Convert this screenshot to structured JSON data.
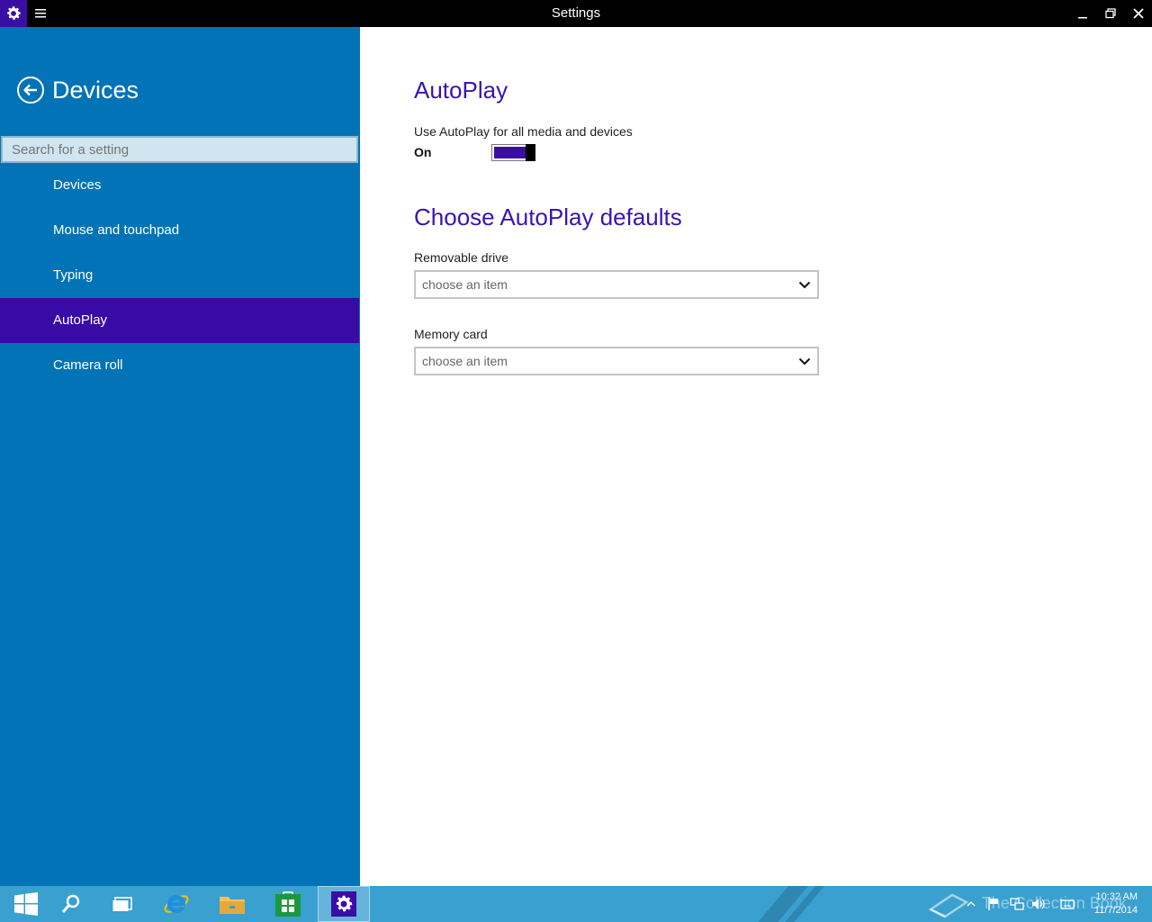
{
  "window": {
    "title": "Settings",
    "minimize_icon": "minimize-icon",
    "restore_icon": "restore-icon",
    "close_icon": "close-icon"
  },
  "sidebar": {
    "title": "Devices",
    "search_placeholder": "Search for a setting",
    "items": [
      {
        "label": "Devices"
      },
      {
        "label": "Mouse and touchpad"
      },
      {
        "label": "Typing"
      },
      {
        "label": "AutoPlay",
        "active": true
      },
      {
        "label": "Camera roll"
      }
    ]
  },
  "main": {
    "heading": "AutoPlay",
    "toggle_label": "Use AutoPlay for all media and devices",
    "toggle_state": "On",
    "defaults_heading": "Choose AutoPlay defaults",
    "removable_label": "Removable drive",
    "removable_value": "choose an item",
    "memory_label": "Memory card",
    "memory_value": "choose an item"
  },
  "taskbar": {
    "watermark": "The Collection Book",
    "time": "10:32 AM",
    "date": "11/7/2014"
  },
  "colors": {
    "accent": "#3b0ea3",
    "sidebar": "#0273b6",
    "taskbar": "#3aa0cf",
    "heading": "#3b14b0"
  }
}
